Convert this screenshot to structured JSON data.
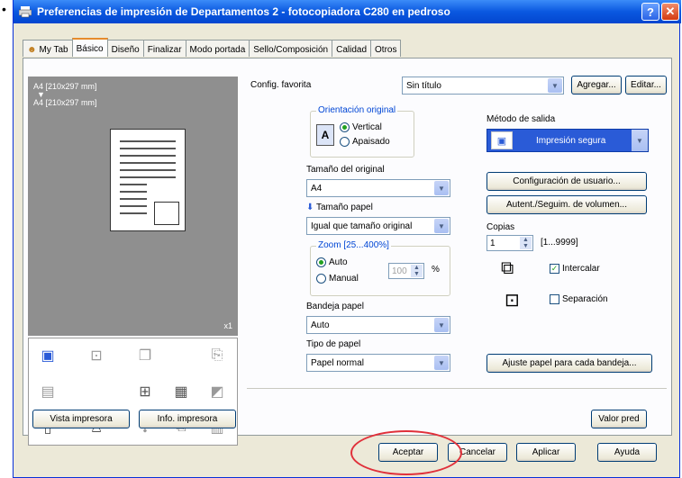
{
  "window": {
    "title": "Preferencias de impresión de Departamentos 2 - fotocopiadora C280 en pedroso",
    "help_glyph": "?",
    "close_glyph": "✕"
  },
  "tabs": [
    {
      "label": "My Tab"
    },
    {
      "label": "Básico"
    },
    {
      "label": "Diseño"
    },
    {
      "label": "Finalizar"
    },
    {
      "label": "Modo portada"
    },
    {
      "label": "Sello/Composición"
    },
    {
      "label": "Calidad"
    },
    {
      "label": "Otros"
    }
  ],
  "preview": {
    "line1": "A4 [210x297 mm]",
    "arrow": "▼",
    "line2": "A4 [210x297 mm]",
    "scale": "x1"
  },
  "favorites": {
    "label": "Config. favorita",
    "value": "Sin título",
    "add_button": "Agregar...",
    "edit_button": "Editar..."
  },
  "orientation": {
    "title": "Orientación original",
    "options": [
      {
        "label": "Vertical",
        "selected": true
      },
      {
        "label": "Apaisado",
        "selected": false
      }
    ]
  },
  "original_size": {
    "label": "Tamaño del original",
    "value": "A4"
  },
  "paper_size": {
    "label": "Tamaño papel",
    "value": "Igual que tamaño original"
  },
  "zoom": {
    "title": "Zoom [25...400%]",
    "options": [
      {
        "label": "Auto",
        "selected": true
      },
      {
        "label": "Manual",
        "selected": false
      }
    ],
    "value": "100",
    "unit": "%"
  },
  "tray": {
    "label": "Bandeja papel",
    "value": "Auto"
  },
  "paper_type": {
    "label": "Tipo de papel",
    "value": "Papel normal"
  },
  "output_method": {
    "label": "Método de salida",
    "value": "Impresión segura"
  },
  "right_buttons": {
    "user_config": "Configuración de usuario...",
    "auth": "Autent./Seguim. de volumen...",
    "tray_adjust": "Ajuste papel para cada bandeja..."
  },
  "copies": {
    "label": "Copias",
    "value": "1",
    "range": "[1...9999]"
  },
  "collate": {
    "label": "Intercalar",
    "checked": true
  },
  "separation": {
    "label": "Separación",
    "checked": false
  },
  "bottom_left": {
    "view_button": "Vista impresora",
    "info_button": "Info. impresora"
  },
  "default_button": "Valor pred",
  "dialog_buttons": {
    "ok": "Aceptar",
    "cancel": "Cancelar",
    "apply": "Aplicar",
    "help": "Ayuda"
  },
  "colors": {
    "titlebar": "#0a58e0",
    "highlight": "#e0303a",
    "group_title": "#0046d5"
  }
}
